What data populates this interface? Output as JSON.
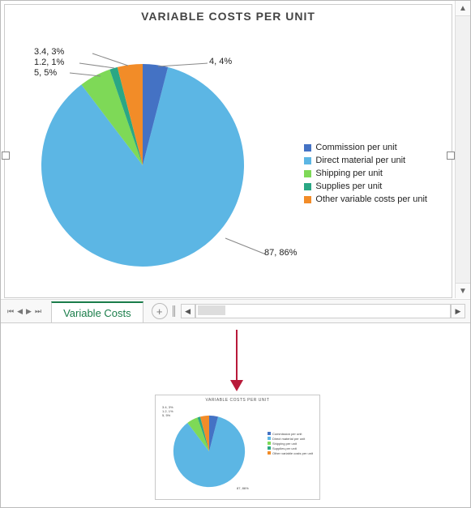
{
  "chart_data": {
    "type": "pie",
    "title": "VARIABLE COSTS PER UNIT",
    "series": [
      {
        "name": "Commission per unit",
        "value": 4,
        "percent": 4,
        "color": "#4472c4"
      },
      {
        "name": "Direct material per unit",
        "value": 87,
        "percent": 86,
        "color": "#5cb6e4"
      },
      {
        "name": "Shipping per unit",
        "value": 5,
        "percent": 5,
        "color": "#7ed957"
      },
      {
        "name": "Supplies per unit",
        "value": 1.2,
        "percent": 1,
        "color": "#2aa784"
      },
      {
        "name": "Other variable costs per unit",
        "value": 3.4,
        "percent": 3,
        "color": "#f28c28"
      }
    ]
  },
  "labels": {
    "commission": "4, 4%",
    "direct": "87, 86%",
    "shipping": "5, 5%",
    "supplies": "1.2, 1%",
    "other": "3.4, 3%"
  },
  "legend": {
    "commission": "Commission per unit",
    "direct": "Direct material per unit",
    "shipping": "Shipping per unit",
    "supplies": "Supplies per unit",
    "other": "Other variable costs per unit"
  },
  "sheet_tab": "Variable Costs",
  "colors": {
    "commission": "#4472c4",
    "direct": "#5cb6e4",
    "shipping": "#7ed957",
    "supplies": "#2aa784",
    "other": "#f28c28"
  }
}
